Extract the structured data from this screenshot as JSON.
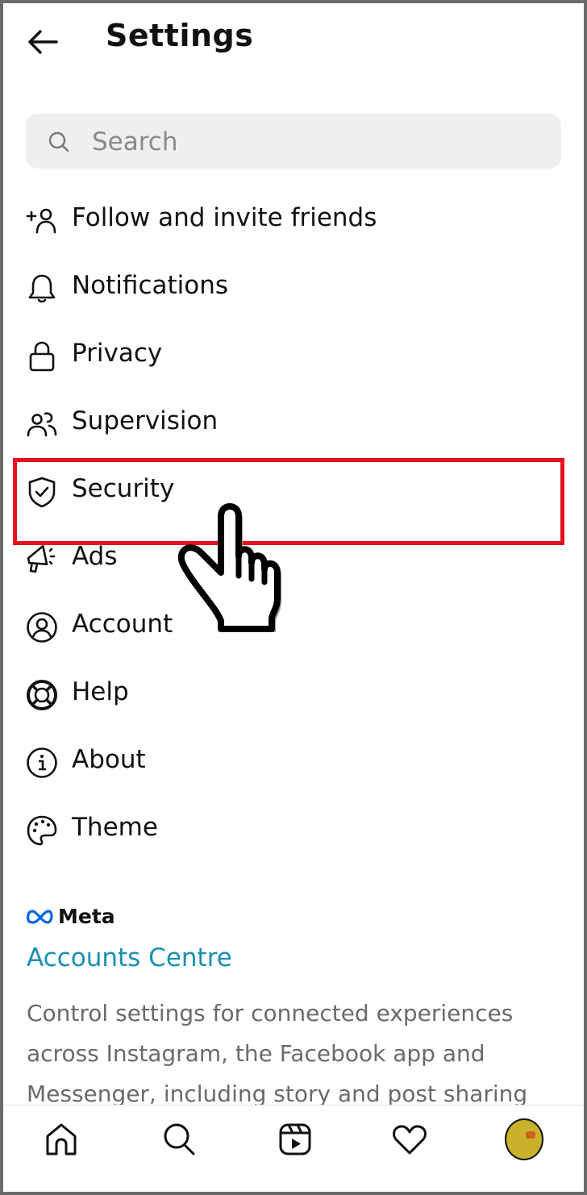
{
  "header": {
    "title": "Settings",
    "back_icon": "arrow-left-icon"
  },
  "search": {
    "placeholder": "Search",
    "value": "",
    "icon": "search-icon"
  },
  "menu": {
    "items": [
      {
        "label": "Follow and invite friends",
        "icon": "add-person-icon"
      },
      {
        "label": "Notifications",
        "icon": "bell-icon"
      },
      {
        "label": "Privacy",
        "icon": "lock-icon"
      },
      {
        "label": "Supervision",
        "icon": "people-icon"
      },
      {
        "label": "Security",
        "icon": "shield-check-icon",
        "highlighted": true
      },
      {
        "label": "Ads",
        "icon": "megaphone-icon"
      },
      {
        "label": "Account",
        "icon": "account-circle-icon"
      },
      {
        "label": "Help",
        "icon": "lifebuoy-icon"
      },
      {
        "label": "About",
        "icon": "info-icon"
      },
      {
        "label": "Theme",
        "icon": "palette-icon"
      }
    ]
  },
  "annotation": {
    "highlight_color": "#e8101c",
    "pointer": "hand-pointer-icon"
  },
  "meta_section": {
    "brand": "Meta",
    "brand_color": "#0668e1",
    "link": "Accounts Centre",
    "link_color": "#1b8fb3",
    "description": "Control settings for connected experiences across Instagram, the Facebook app and Messenger, including story and post sharing"
  },
  "bottom_nav": {
    "items": [
      {
        "name": "home",
        "icon": "home-icon"
      },
      {
        "name": "search",
        "icon": "search-icon"
      },
      {
        "name": "reels",
        "icon": "reels-icon"
      },
      {
        "name": "activity",
        "icon": "heart-icon"
      },
      {
        "name": "profile",
        "icon": "avatar"
      }
    ]
  }
}
